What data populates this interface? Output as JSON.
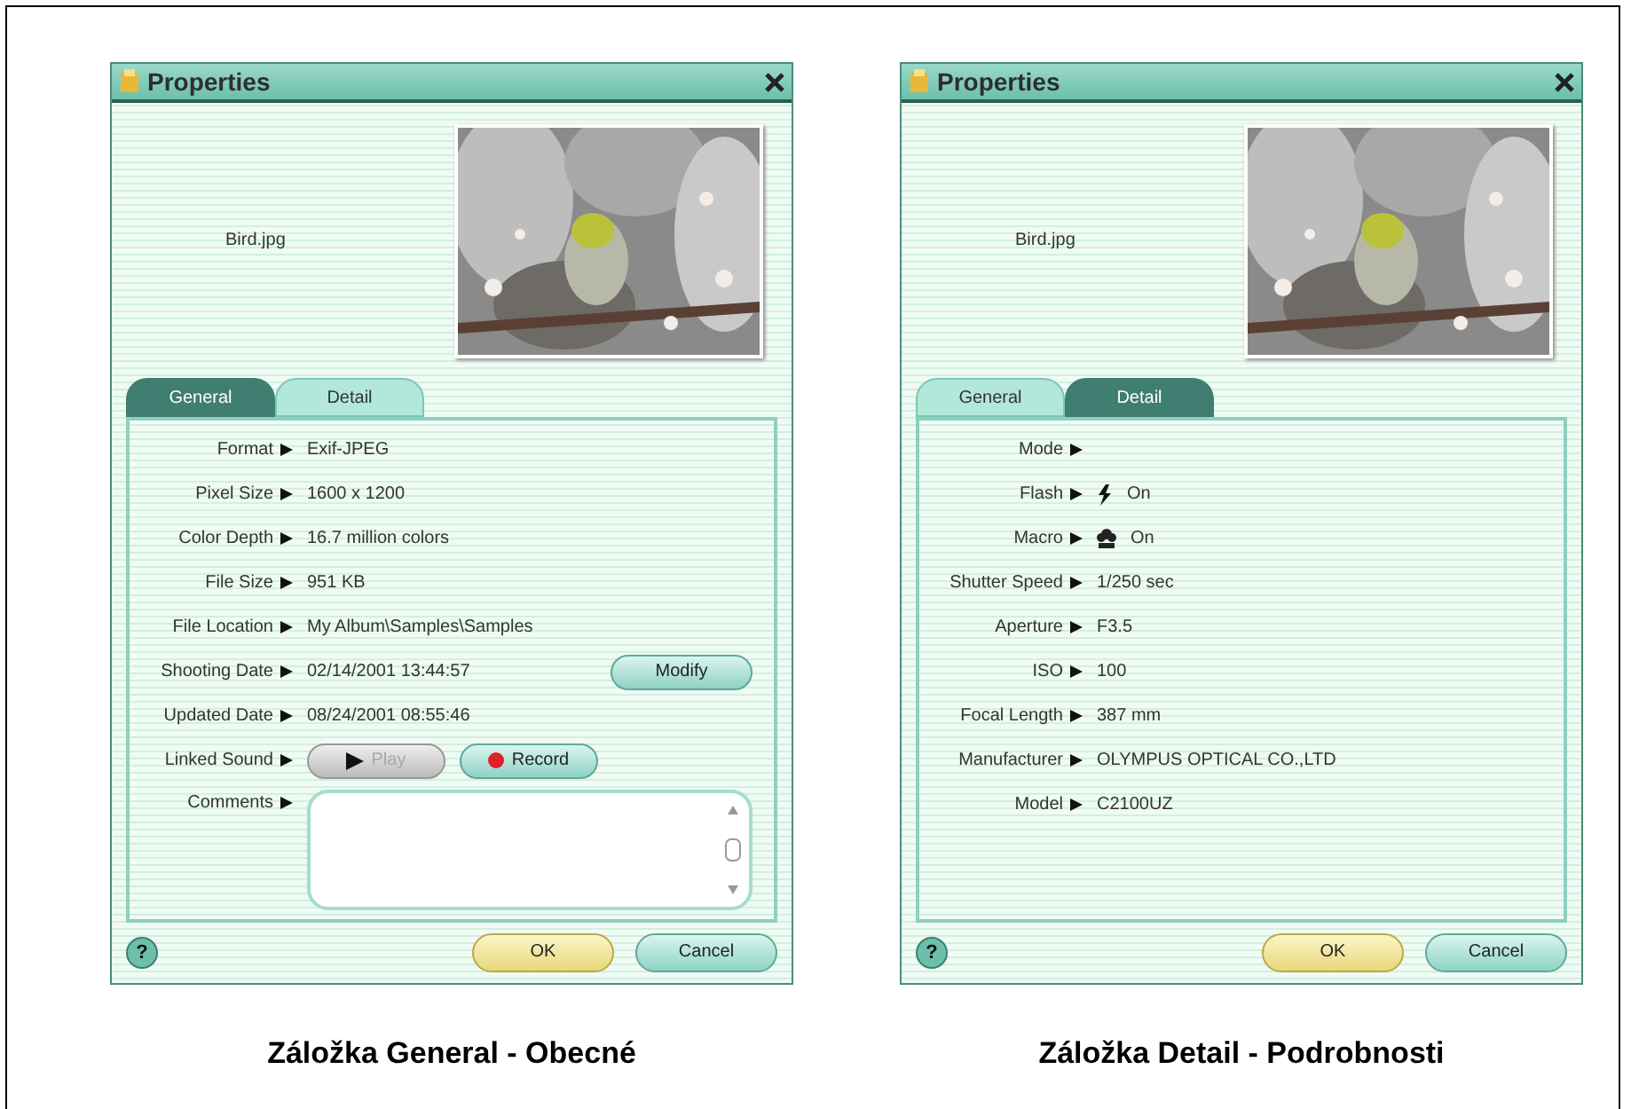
{
  "dialogs": [
    {
      "title": "Properties",
      "filename": "Bird.jpg",
      "tabs": [
        {
          "label": "General",
          "selected": true
        },
        {
          "label": "Detail",
          "selected": false
        }
      ],
      "rows": [
        {
          "kind": "text",
          "label": "Format",
          "value": "Exif-JPEG"
        },
        {
          "kind": "text",
          "label": "Pixel Size",
          "value": "1600 x 1200"
        },
        {
          "kind": "text",
          "label": "Color Depth",
          "value": "16.7 million colors"
        },
        {
          "kind": "text",
          "label": "File Size",
          "value": "951 KB"
        },
        {
          "kind": "text",
          "label": "File Location",
          "value": "My Album\\Samples\\Samples"
        },
        {
          "kind": "modify",
          "label": "Shooting Date",
          "value": "02/14/2001 13:44:57",
          "button": "Modify"
        },
        {
          "kind": "text",
          "label": "Updated Date",
          "value": "08/24/2001 08:55:46"
        },
        {
          "kind": "sound",
          "label": "Linked Sound",
          "buttons": [
            {
              "kind": "play",
              "label": "Play",
              "disabled": true
            },
            {
              "kind": "record",
              "label": "Record",
              "disabled": false
            }
          ]
        },
        {
          "kind": "comments",
          "label": "Comments"
        }
      ],
      "help": "?",
      "ok": "OK",
      "cancel": "Cancel",
      "caption": "Záložka General - Obecné"
    },
    {
      "title": "Properties",
      "filename": "Bird.jpg",
      "tabs": [
        {
          "label": "General",
          "selected": false
        },
        {
          "label": "Detail",
          "selected": true
        }
      ],
      "rows": [
        {
          "kind": "text",
          "label": "Mode"
        },
        {
          "kind": "flash",
          "label": "Flash",
          "value": "On"
        },
        {
          "kind": "macro",
          "label": "Macro",
          "value": "On"
        },
        {
          "kind": "text",
          "label": "Shutter Speed",
          "value": "1/250 sec"
        },
        {
          "kind": "text",
          "label": "Aperture",
          "value": "F3.5"
        },
        {
          "kind": "text",
          "label": "ISO",
          "value": "100"
        },
        {
          "kind": "text",
          "label": "Focal Length",
          "value": "387 mm"
        },
        {
          "kind": "text",
          "label": "Manufacturer",
          "value": "OLYMPUS OPTICAL CO.,LTD"
        },
        {
          "kind": "text",
          "label": "Model",
          "value": "C2100UZ"
        }
      ],
      "help": "?",
      "ok": "OK",
      "cancel": "Cancel",
      "caption": "Záložka Detail - Podrobnosti"
    }
  ]
}
